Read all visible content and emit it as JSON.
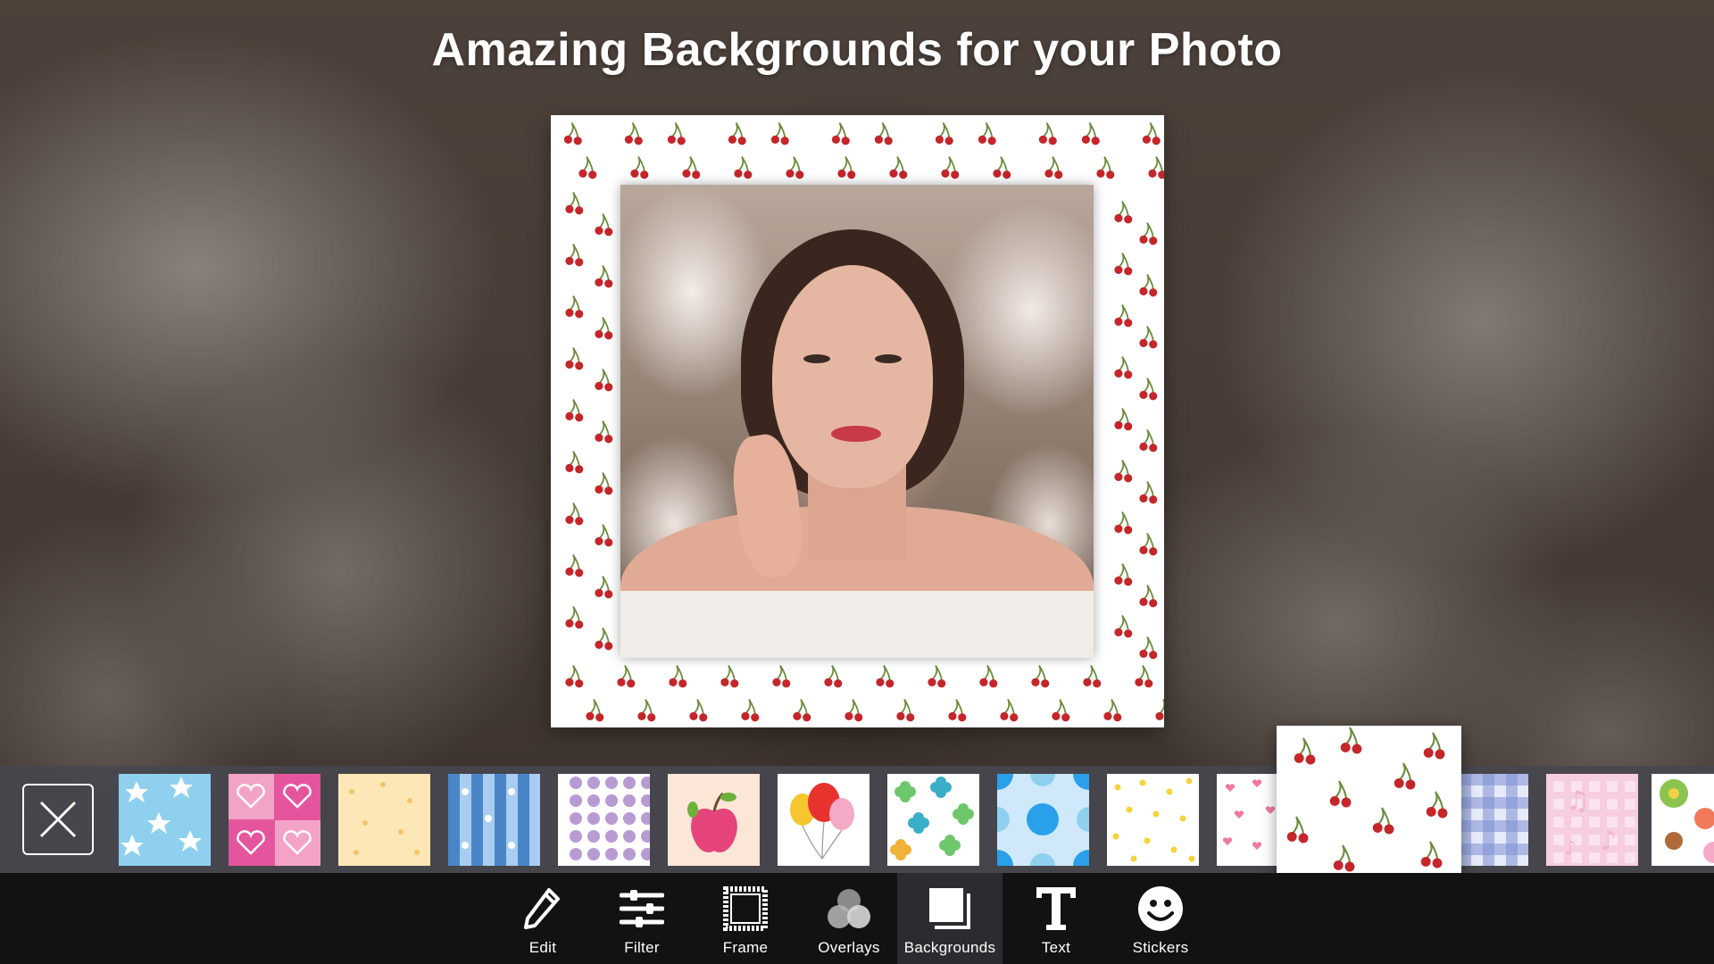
{
  "header": {
    "title": "Amazing Backgrounds for your Photo"
  },
  "strip": {
    "close_icon": "close-x-icon",
    "thumbnails": [
      {
        "name": "stars-blue",
        "color": "#7dc6ea"
      },
      {
        "name": "hearts-pink",
        "color": "#e5559d"
      },
      {
        "name": "dots-cream",
        "color": "#fde7b6"
      },
      {
        "name": "stripes-blue",
        "color": "#4a86c7"
      },
      {
        "name": "dots-purple",
        "color": "#b99bd4"
      },
      {
        "name": "apple-peach",
        "color": "#fbe6d8"
      },
      {
        "name": "balloons",
        "color": "#ffffff"
      },
      {
        "name": "flowers-green",
        "color": "#6fc76c"
      },
      {
        "name": "circles-blue",
        "color": "#2aa0ea"
      },
      {
        "name": "dots-yellow",
        "color": "#f6d23c"
      },
      {
        "name": "hearts-tiny",
        "color": "#f07a9c"
      },
      {
        "name": "cherries-selected",
        "color": "#c4262a"
      },
      {
        "name": "gingham-blue",
        "color": "#7e8fd2"
      },
      {
        "name": "notes-pink",
        "color": "#f2b4d4"
      },
      {
        "name": "buttons-floral",
        "color": "#8ac44e"
      }
    ],
    "selected_index": 11
  },
  "toolbar": {
    "items": [
      {
        "label": "Edit",
        "icon": "pencil-icon"
      },
      {
        "label": "Filter",
        "icon": "sliders-icon"
      },
      {
        "label": "Frame",
        "icon": "frame-icon"
      },
      {
        "label": "Overlays",
        "icon": "overlays-icon"
      },
      {
        "label": "Backgrounds",
        "icon": "backgrounds-icon",
        "active": true
      },
      {
        "label": "Text",
        "icon": "text-icon"
      },
      {
        "label": "Stickers",
        "icon": "smiley-icon"
      }
    ]
  },
  "colors": {
    "strip_bg": "#46464e",
    "toolbar_bg": "#121212",
    "toolbar_active": "#2c2c30",
    "cherry": "#c4262a"
  }
}
